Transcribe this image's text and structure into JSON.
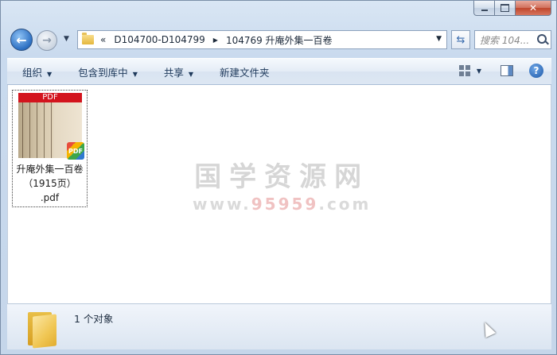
{
  "window": {
    "caption_buttons": {
      "minimize": "minimize",
      "maximize": "maximize",
      "close": "✕"
    }
  },
  "nav": {
    "breadcrumb_overflow": "«",
    "breadcrumbs": [
      "D104700-D104799",
      "104769 升庵外集一百卷"
    ],
    "search_placeholder": "搜索 104...",
    "refresh_icon": "refresh-icon"
  },
  "toolbar": {
    "organize": "组织",
    "include_in_library": "包含到库中",
    "share": "共享",
    "new_folder": "新建文件夹"
  },
  "content": {
    "watermark_main": "国学资源网",
    "watermark_sub_prefix": "www.",
    "watermark_sub_number": "95959",
    "watermark_sub_suffix": ".com",
    "files": [
      {
        "thumb_label": "PDF",
        "badge": "PDF",
        "name_line1": "升庵外集一百卷",
        "name_line2": "（1915页）",
        "name_line3": ".pdf"
      }
    ]
  },
  "details": {
    "summary": "1 个对象"
  },
  "colors": {
    "accent": "#1e395b",
    "pdf_red": "#d3141d",
    "window_bg": "#c9daee"
  }
}
